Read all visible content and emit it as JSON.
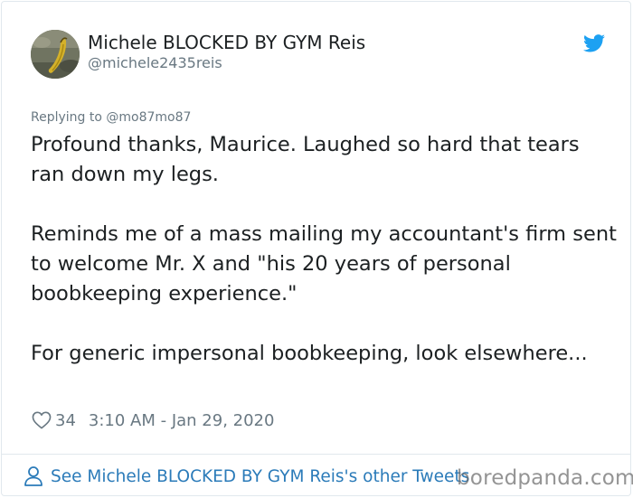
{
  "author": {
    "display_name": "Michele BLOCKED BY GYM Reis",
    "handle": "@michele2435reis"
  },
  "icons": {
    "platform": "twitter-bird-icon",
    "like": "heart-icon",
    "profile": "person-icon"
  },
  "tweet": {
    "replying_to": "Replying to @mo87mo87",
    "paragraphs": [
      "Profound thanks, Maurice. Laughed so hard that tears ran down my legs.",
      "Reminds me of a mass mailing my accountant's firm sent to welcome Mr. X and \"his 20 years of personal boobkeeping experience.\"",
      "For generic impersonal boobkeeping, look elsewhere..."
    ],
    "likes": "34",
    "timestamp": "3:10 AM - Jan 29, 2020"
  },
  "footer": {
    "link_text": "See Michele BLOCKED BY GYM Reis's other Tweets"
  },
  "watermark": "boredpanda.com",
  "colors": {
    "text": "#1c2022",
    "muted": "#697882",
    "link": "#2b7bb9",
    "twitter_blue": "#1da1f2",
    "border": "#e1e8ed"
  }
}
